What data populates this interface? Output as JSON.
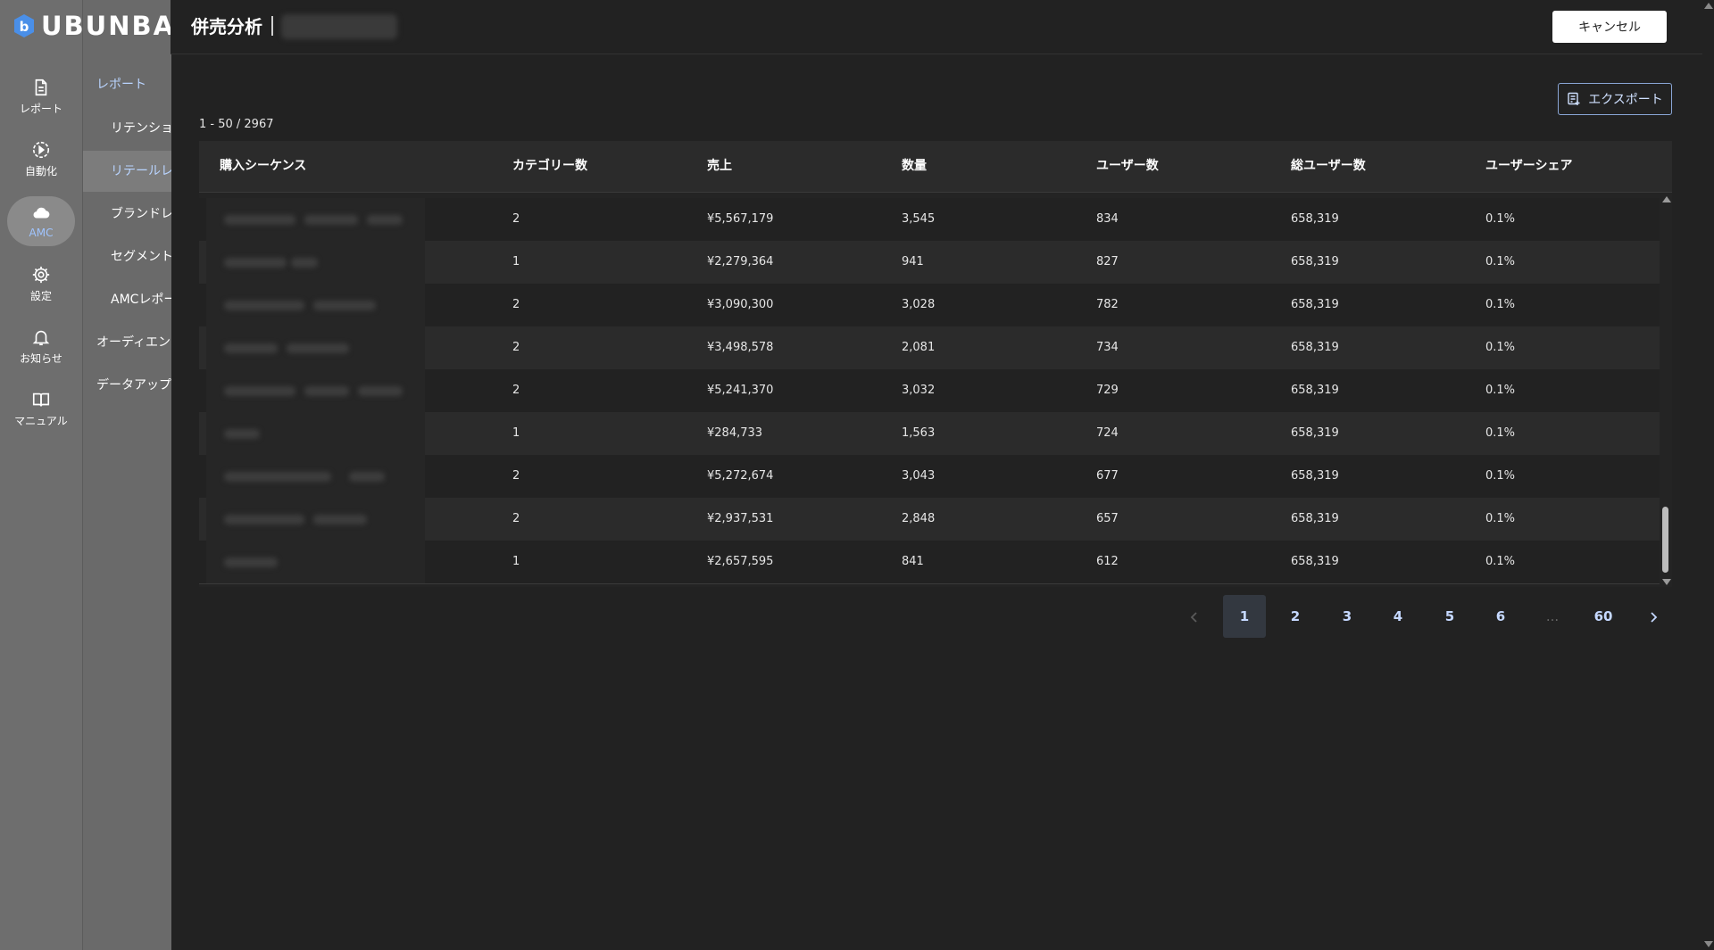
{
  "app": {
    "logo_text": "UBUNBAS",
    "page_title": "併売分析",
    "cancel_label": "キャンセル",
    "export_label": "エクスポート"
  },
  "rail": [
    {
      "label": "レポート",
      "icon": "report-icon"
    },
    {
      "label": "自動化",
      "icon": "automation-icon"
    },
    {
      "label": "AMC",
      "icon": "cloud-icon",
      "active": true
    },
    {
      "label": "設定",
      "icon": "gear-icon"
    },
    {
      "label": "お知らせ",
      "icon": "bell-icon"
    },
    {
      "label": "マニュアル",
      "icon": "book-icon"
    }
  ],
  "subnav": [
    {
      "label": "レポート",
      "level": 1,
      "section": true
    },
    {
      "label": "リテンションレ",
      "level": 2
    },
    {
      "label": "リテールレポ",
      "level": 2,
      "active": true
    },
    {
      "label": "ブランドレポ",
      "level": 2
    },
    {
      "label": "セグメント注",
      "level": 2
    },
    {
      "label": "AMCレポー",
      "level": 2
    },
    {
      "label": "オーディエンス作",
      "level": 1
    },
    {
      "label": "データアップロー",
      "level": 1
    }
  ],
  "table": {
    "range_text": "1 - 50 / 2967",
    "columns": [
      "購入シーケンス",
      "カテゴリー数",
      "売上",
      "数量",
      "ユーザー数",
      "総ユーザー数",
      "ユーザーシェア"
    ],
    "rows": [
      [
        "",
        "2",
        "¥5,567,179",
        "3,545",
        "834",
        "658,319",
        "0.1%"
      ],
      [
        "",
        "1",
        "¥2,279,364",
        "941",
        "827",
        "658,319",
        "0.1%"
      ],
      [
        "",
        "2",
        "¥3,090,300",
        "3,028",
        "782",
        "658,319",
        "0.1%"
      ],
      [
        "",
        "2",
        "¥3,498,578",
        "2,081",
        "734",
        "658,319",
        "0.1%"
      ],
      [
        "",
        "2",
        "¥5,241,370",
        "3,032",
        "729",
        "658,319",
        "0.1%"
      ],
      [
        "",
        "1",
        "¥284,733",
        "1,563",
        "724",
        "658,319",
        "0.1%"
      ],
      [
        "",
        "2",
        "¥5,272,674",
        "3,043",
        "677",
        "658,319",
        "0.1%"
      ],
      [
        "",
        "2",
        "¥2,937,531",
        "2,848",
        "657",
        "658,319",
        "0.1%"
      ],
      [
        "",
        "1",
        "¥2,657,595",
        "841",
        "612",
        "658,319",
        "0.1%"
      ]
    ]
  },
  "pagination": {
    "pages": [
      "1",
      "2",
      "3",
      "4",
      "5",
      "6",
      "...",
      "60"
    ],
    "current": "1"
  },
  "colors": {
    "background": "#222222",
    "rail": "#6e6e6e",
    "subnav": "#6a6a6a",
    "accent": "#9fc4ff"
  }
}
